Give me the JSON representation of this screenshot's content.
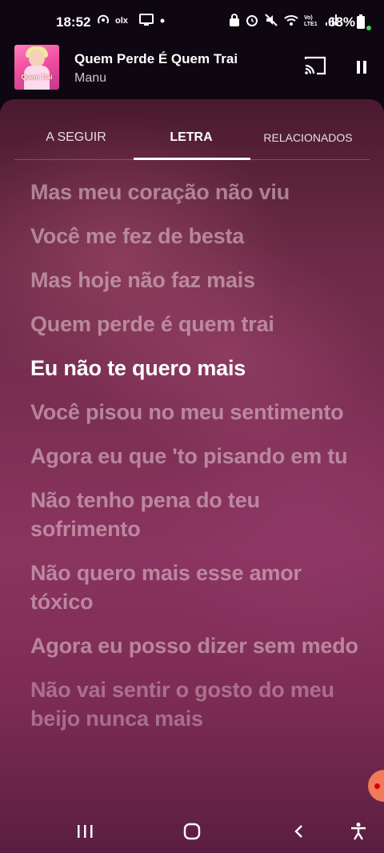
{
  "status_bar": {
    "time": "18:52",
    "battery": "68%",
    "icons_left": [
      "hotspot-icon",
      "olx-icon",
      "screen-icon",
      "dot"
    ],
    "icons_right": [
      "lock-icon",
      "alarm-icon",
      "mute-icon",
      "wifi-icon",
      "volte-icon",
      "signal-icon",
      "battery-icon"
    ]
  },
  "now_playing": {
    "title": "Quem Perde É Quem Trai",
    "artist": "Manu",
    "art_text": "Quem Trai"
  },
  "tabs": [
    {
      "label": "A SEGUIR",
      "active": false
    },
    {
      "label": "LETRA",
      "active": true
    },
    {
      "label": "RELACIONADOS",
      "active": false
    }
  ],
  "lyrics": [
    {
      "text": "Mas meu coração não viu",
      "current": false
    },
    {
      "text": "Você me fez de besta",
      "current": false
    },
    {
      "text": "Mas hoje não faz mais",
      "current": false
    },
    {
      "text": "Quem perde é quem trai",
      "current": false
    },
    {
      "text": "Eu não te quero mais",
      "current": true
    },
    {
      "text": "Você pisou no meu sentimento",
      "current": false
    },
    {
      "text": "Agora eu que 'to pisando em tu",
      "current": false
    },
    {
      "text": "Não tenho pena do teu sofrimento",
      "current": false
    },
    {
      "text": "Não quero mais esse amor tóxico",
      "current": false
    },
    {
      "text": "Agora eu posso dizer sem medo",
      "current": false
    },
    {
      "text": "Não vai sentir o gosto do meu beijo nunca mais",
      "current": false
    }
  ],
  "colors": {
    "accent": "#ffffff",
    "panel_bg": "#7a2e52",
    "current_line": "#ffffff",
    "inactive_line": "#e2c4ce"
  }
}
